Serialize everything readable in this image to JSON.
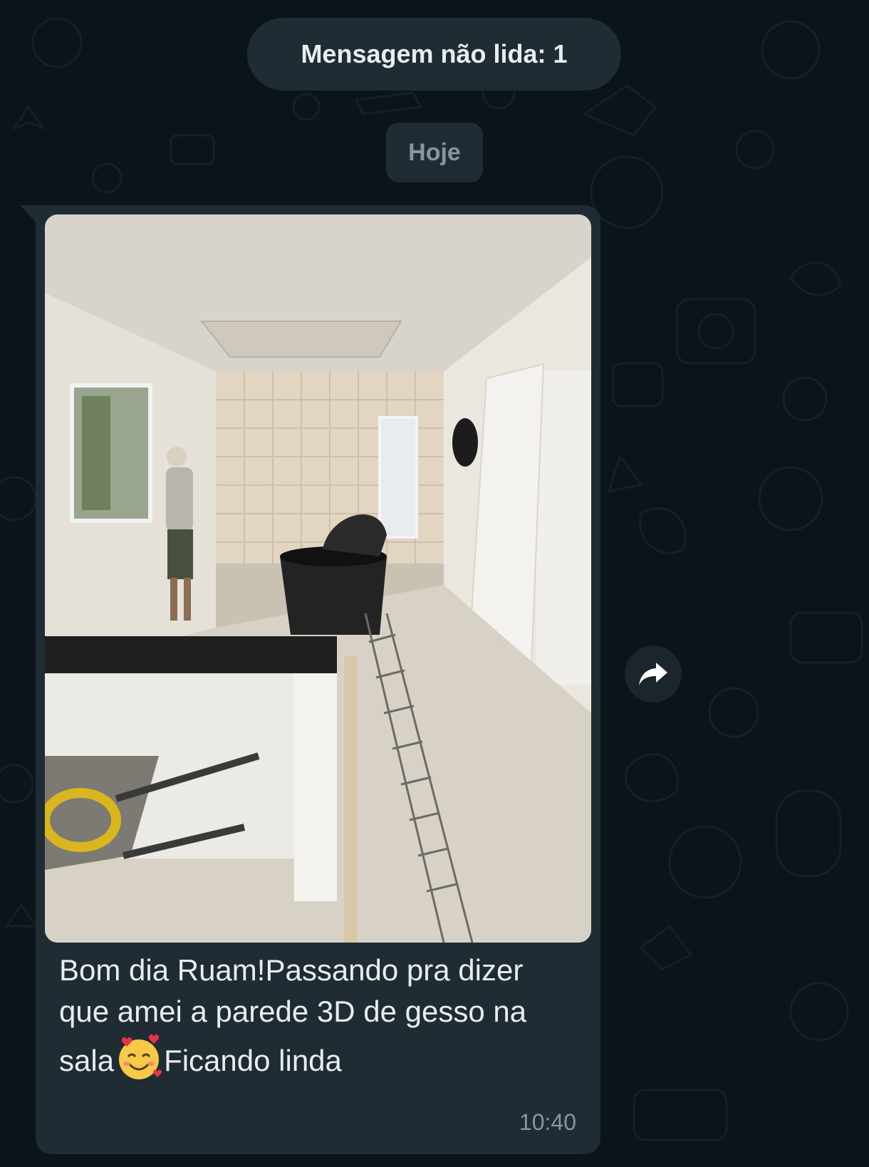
{
  "chat": {
    "unread_banner": "Mensagem não lida: 1",
    "date_label": "Hoje"
  },
  "message": {
    "caption_part1": "Bom dia Ruam!Passando pra dizer que amei a parede 3D de gesso na sala",
    "emoji": "smiling-face-with-hearts",
    "caption_part2": "Ficando linda",
    "time": "10:40",
    "photo_description_icon": "construction-room-photo"
  },
  "icons": {
    "forward": "forward-arrow-icon"
  },
  "colors": {
    "background": "#0b141a",
    "bubble": "#1f2c34",
    "text": "#e9edef",
    "muted": "#8696a0"
  }
}
